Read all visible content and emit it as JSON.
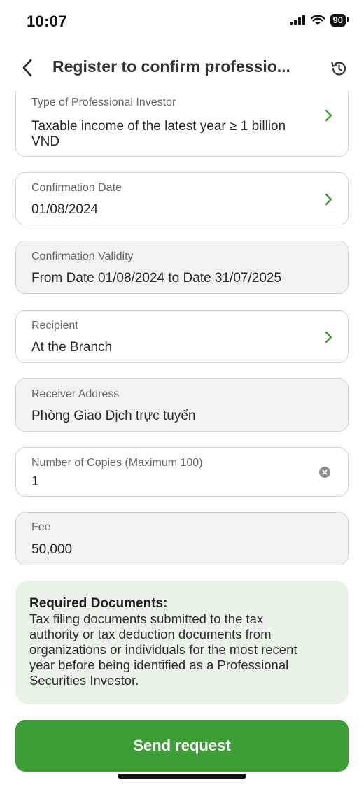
{
  "status_bar": {
    "time": "10:07",
    "battery": "90"
  },
  "header": {
    "title": "Register to confirm professio..."
  },
  "fields": {
    "investor_type": {
      "label": "Type of Professional Investor",
      "value_line1": "Taxable income of the latest year ≥ 1 billion",
      "value_line2": "VND"
    },
    "confirmation_date": {
      "label": "Confirmation Date",
      "value": "01/08/2024"
    },
    "validity": {
      "label": "Confirmation Validity",
      "value": "From Date 01/08/2024 to Date 31/07/2025"
    },
    "recipient": {
      "label": "Recipient",
      "value": "At the Branch"
    },
    "receiver_address": {
      "label": "Receiver Address",
      "value": "Phòng Giao Dịch trực tuyến"
    },
    "copies": {
      "label": "Number of Copies (Maximum 100)",
      "value": "1"
    },
    "fee": {
      "label": "Fee",
      "value": "50,000"
    }
  },
  "note": {
    "title": "Required Documents:",
    "lines": [
      "Tax filing documents submitted to the tax",
      "authority or tax deduction documents from",
      "organizations or individuals for the most recent",
      "year before being identified as a Professional",
      "Securities Investor."
    ]
  },
  "actions": {
    "send_label": "Send request"
  },
  "colors": {
    "accent": "#3e9e36",
    "note_bg": "#eaf3e8",
    "readonly_bg": "#f2f2f2"
  },
  "icons": [
    "back-arrow-icon",
    "history-icon",
    "chevron-right-icon",
    "clear-icon",
    "signal-icon",
    "wifi-icon",
    "battery-icon"
  ]
}
